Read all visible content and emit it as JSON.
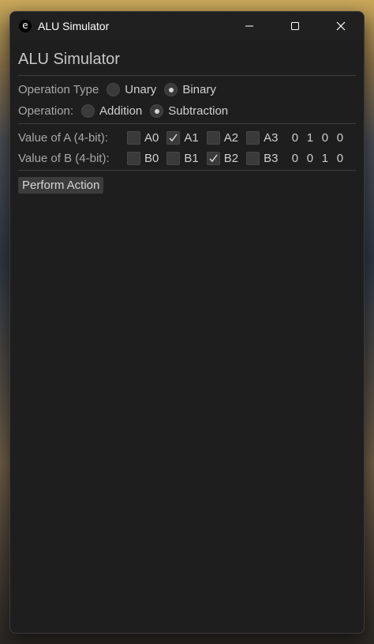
{
  "window": {
    "title": "ALU Simulator",
    "app_icon_glyph": "e"
  },
  "main": {
    "heading": "ALU Simulator",
    "operation_type": {
      "label": "Operation Type",
      "options": [
        {
          "label": "Unary",
          "selected": false
        },
        {
          "label": "Binary",
          "selected": true
        }
      ]
    },
    "operation": {
      "label": "Operation:",
      "options": [
        {
          "label": "Addition",
          "selected": false
        },
        {
          "label": "Subtraction",
          "selected": true
        }
      ]
    },
    "value_a": {
      "label": "Value of A (4-bit):",
      "bits": [
        {
          "label": "A0",
          "checked": false
        },
        {
          "label": "A1",
          "checked": true
        },
        {
          "label": "A2",
          "checked": false
        },
        {
          "label": "A3",
          "checked": false
        }
      ],
      "digits": [
        "0",
        "1",
        "0",
        "0"
      ]
    },
    "value_b": {
      "label": "Value of B (4-bit):",
      "bits": [
        {
          "label": "B0",
          "checked": false
        },
        {
          "label": "B1",
          "checked": false
        },
        {
          "label": "B2",
          "checked": true
        },
        {
          "label": "B3",
          "checked": false
        }
      ],
      "digits": [
        "0",
        "0",
        "1",
        "0"
      ]
    },
    "action_button": "Perform Action"
  },
  "colors": {
    "window_bg": "#1e1e1e",
    "titlebar_bg": "#202020",
    "control_bg": "#3a3a3a",
    "text": "#d0d0d0"
  },
  "icons": [
    "app-icon",
    "minimize-icon",
    "maximize-icon",
    "close-icon",
    "checkmark-icon",
    "radio-dot-icon"
  ]
}
